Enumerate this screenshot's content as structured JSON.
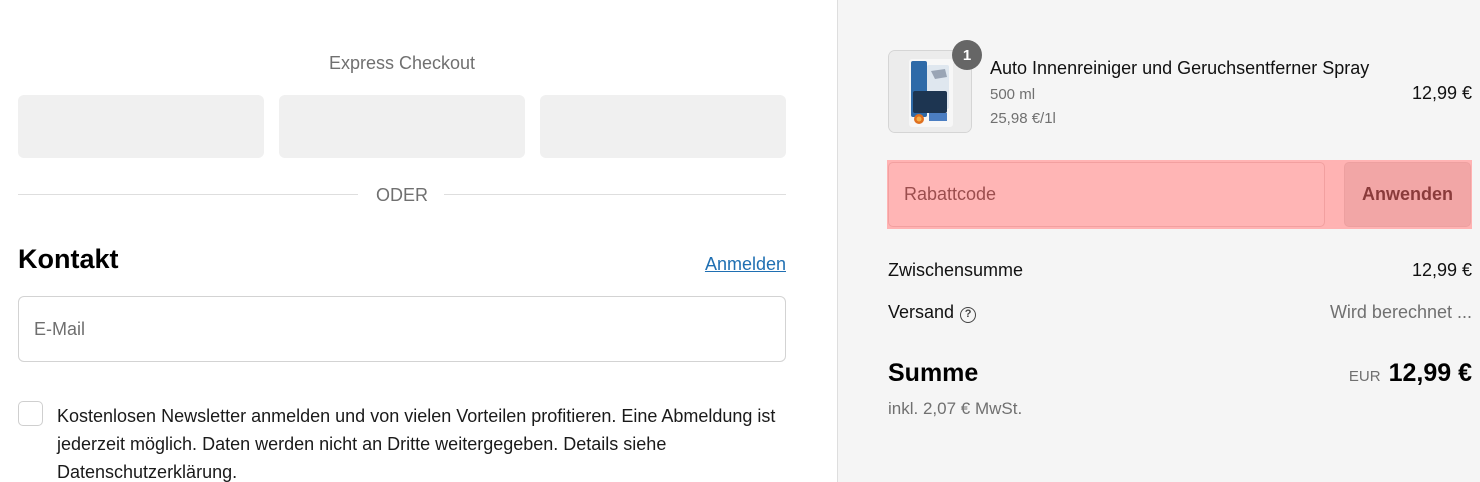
{
  "express": {
    "title": "Express Checkout",
    "divider_label": "ODER"
  },
  "contact": {
    "heading": "Kontakt",
    "login_link": "Anmelden",
    "email_placeholder": "E-Mail",
    "newsletter_text": "Kostenlosen Newsletter anmelden und von vielen Vorteilen profitieren. Eine Abmeldung ist jederzeit möglich. Daten werden nicht an Dritte weitergegeben. Details siehe Datenschutzerklärung."
  },
  "cart": {
    "item": {
      "quantity": "1",
      "name": "Auto Innenreiniger und Geruchsentferner Spray",
      "size": "500 ml",
      "unit_price": "25,98 €/1l",
      "price": "12,99 €"
    },
    "discount": {
      "placeholder": "Rabattcode",
      "apply_label": "Anwenden"
    },
    "subtotal_label": "Zwischensumme",
    "subtotal_value": "12,99 €",
    "shipping_label": "Versand",
    "shipping_value": "Wird berechnet ...",
    "total_label": "Summe",
    "currency": "EUR",
    "total_value": "12,99 €",
    "tax_note": "inkl. 2,07 € MwSt."
  },
  "colors": {
    "link": "#1f6fb2",
    "badge": "#666666",
    "discount_highlight": "#ffb3b3"
  }
}
